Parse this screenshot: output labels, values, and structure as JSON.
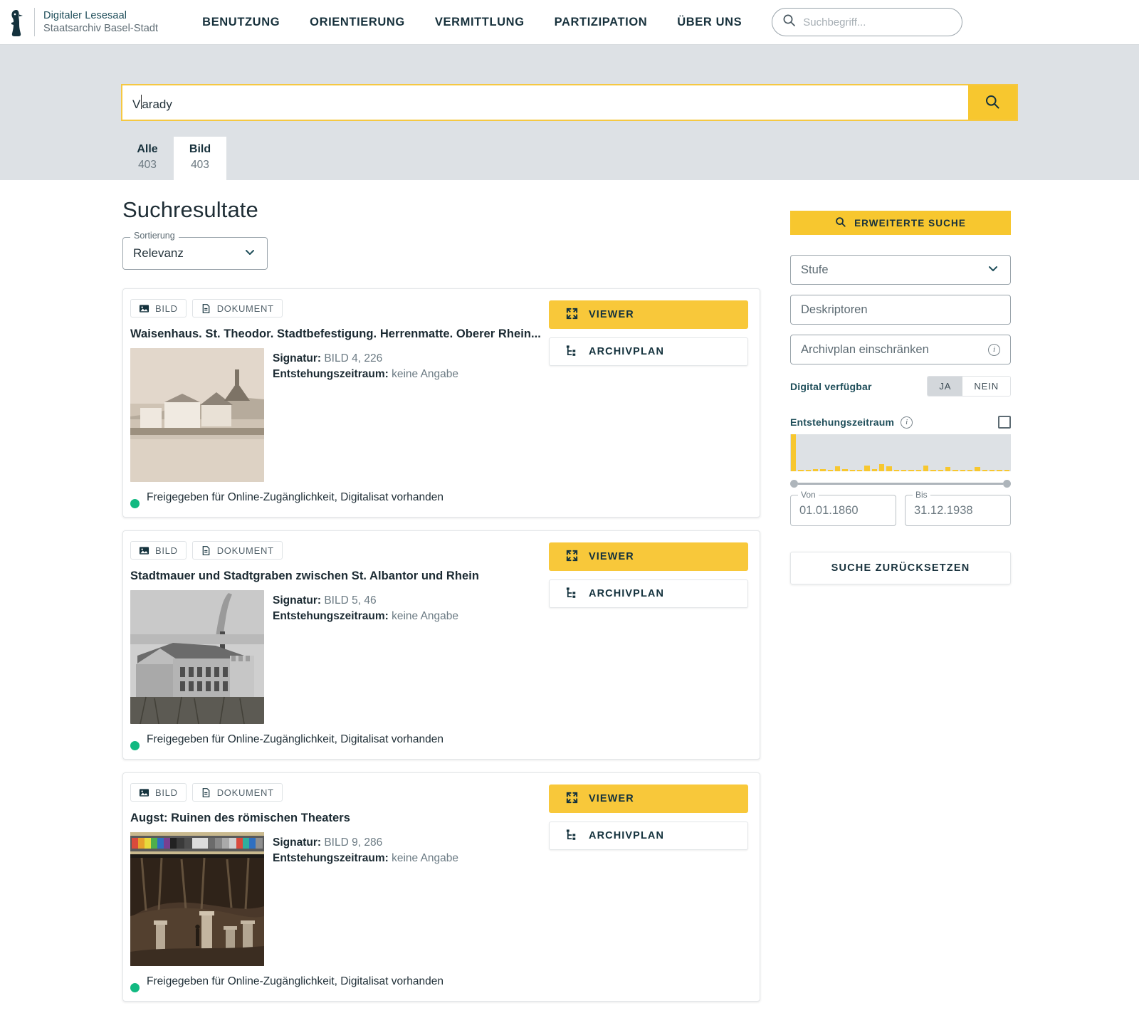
{
  "header": {
    "brand": {
      "line1": "Digitaler Lesesaal",
      "line2": "Staatsarchiv Basel-Stadt",
      "logo_icon": "archive-bird-logo-icon"
    },
    "nav": [
      {
        "label": "BENUTZUNG"
      },
      {
        "label": "ORIENTIERUNG"
      },
      {
        "label": "VERMITTLUNG"
      },
      {
        "label": "PARTIZIPATION"
      },
      {
        "label": "ÜBER UNS"
      }
    ],
    "navsearch": {
      "placeholder": "Suchbegriff...",
      "value": "",
      "icon": "search-icon"
    }
  },
  "hero": {
    "search": {
      "value_before_caret": "V",
      "value_after_caret": "arady",
      "full_value": "Varady",
      "submit_icon": "search-icon",
      "accent": "#f7c72f"
    },
    "tabs": [
      {
        "label": "Alle",
        "count": "403",
        "active": false
      },
      {
        "label": "Bild",
        "count": "403",
        "active": true
      }
    ],
    "background": "#dde1e5"
  },
  "main": {
    "title": "Suchresultate",
    "sort": {
      "label": "Sortierung",
      "value": "Relevanz",
      "icon": "chevron-down-icon"
    },
    "results": [
      {
        "chips": [
          {
            "label": "BILD",
            "icon": "image-icon"
          },
          {
            "label": "DOKUMENT",
            "icon": "document-icon"
          }
        ],
        "title": "Waisenhaus. St. Theodor. Stadtbefestigung. Herrenmatte. Oberer Rhein...",
        "signatur_label": "Signatur:",
        "signatur_value": "BILD 4, 226",
        "zeitraum_label": "Entstehungszeitraum:",
        "zeitraum_value": "keine Angabe",
        "status": "Freigegeben für Online-Zugänglichkeit, Digitalisat vorhanden",
        "status_color": "#12b981",
        "viewer_label": "VIEWER",
        "archivplan_label": "ARCHIVPLAN",
        "thumb": "sepia-riverfront-photo"
      },
      {
        "chips": [
          {
            "label": "BILD",
            "icon": "image-icon"
          },
          {
            "label": "DOKUMENT",
            "icon": "document-icon"
          }
        ],
        "title": "Stadtmauer und Stadtgraben zwischen St. Albantor und Rhein",
        "signatur_label": "Signatur:",
        "signatur_value": "BILD 5, 46",
        "zeitraum_label": "Entstehungszeitraum:",
        "zeitraum_value": "keine Angabe",
        "status": "Freigegeben für Online-Zugänglichkeit, Digitalisat vorhanden",
        "status_color": "#12b981",
        "viewer_label": "VIEWER",
        "archivplan_label": "ARCHIVPLAN",
        "thumb": "bw-city-wall-factory-photo"
      },
      {
        "chips": [
          {
            "label": "BILD",
            "icon": "image-icon"
          },
          {
            "label": "DOKUMENT",
            "icon": "document-icon"
          }
        ],
        "title": "Augst: Ruinen des römischen Theaters",
        "signatur_label": "Signatur:",
        "signatur_value": "BILD 9, 286",
        "zeitraum_label": "Entstehungszeitraum:",
        "zeitraum_value": "keine Angabe",
        "status": "Freigegeben für Online-Zugänglichkeit, Digitalisat vorhanden",
        "status_color": "#12b981",
        "viewer_label": "VIEWER",
        "archivplan_label": "ARCHIVPLAN",
        "thumb": "roman-theatre-ruins-with-colorchart"
      }
    ]
  },
  "sidebar": {
    "advanced_button": {
      "label": "ERWEITERTE SUCHE",
      "icon": "search-icon"
    },
    "fields": [
      {
        "name": "stufe",
        "placeholder": "Stufe",
        "value": "",
        "trailing_icon": "chevron-down-icon"
      },
      {
        "name": "deskriptoren",
        "placeholder": "Deskriptoren",
        "value": "",
        "trailing_icon": ""
      },
      {
        "name": "archivplan",
        "placeholder": "Archivplan einschränken",
        "value": "",
        "trailing_icon": "info-icon"
      }
    ],
    "digital": {
      "label": "Digital verfügbar",
      "options": [
        "JA",
        "NEIN"
      ],
      "selected": "JA"
    },
    "period": {
      "label": "Entstehungszeitraum",
      "info_icon": "info-icon",
      "checkbox_checked": false,
      "from": {
        "caption": "Von",
        "value": "01.01.1860"
      },
      "to": {
        "caption": "Bis",
        "value": "31.12.1938"
      },
      "histogram": [
        100,
        4,
        3,
        5,
        6,
        3,
        14,
        5,
        4,
        3,
        16,
        5,
        20,
        14,
        3,
        3,
        4,
        3,
        16,
        4,
        3,
        11,
        3,
        3,
        3,
        11,
        3,
        2,
        2,
        2
      ]
    },
    "reset_button": {
      "label": "SUCHE ZURÜCKSETZEN"
    }
  }
}
